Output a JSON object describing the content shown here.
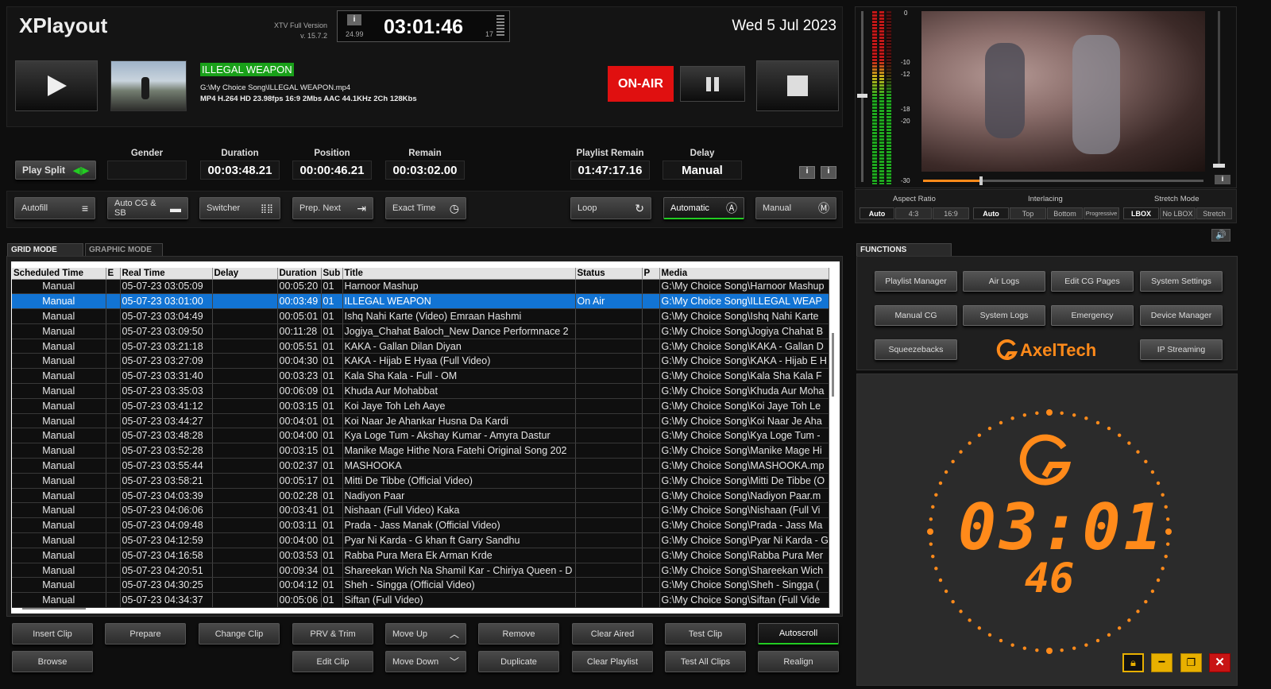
{
  "header": {
    "app_title": "XPlayout",
    "version_line1": "XTV Full Version",
    "version_line2": "v. 15.7.2",
    "clock": "03:01:46",
    "fps_left": "24.99",
    "fps_right": "17",
    "date": "Wed 5 Jul 2023"
  },
  "now_playing": {
    "title": "ILLEGAL WEAPON",
    "path": "G:\\My Choice Song\\ILLEGAL WEAPON.mp4",
    "specs": "MP4 H.264 HD 23.98fps 16:9 2Mbs AAC 44.1KHz 2Ch 128Kbs",
    "on_air": "ON-AIR"
  },
  "stats": {
    "play_split": "Play Split",
    "gender_label": "Gender",
    "gender_value": "",
    "duration_label": "Duration",
    "duration_value": "00:03:48.21",
    "position_label": "Position",
    "position_value": "00:00:46.21",
    "remain_label": "Remain",
    "remain_value": "00:03:02.00",
    "playlist_remain_label": "Playlist Remain",
    "playlist_remain_value": "01:47:17.16",
    "delay_label": "Delay",
    "delay_value": "Manual"
  },
  "toolbar": {
    "autofill": "Autofill",
    "auto_cg": "Auto CG & SB",
    "switcher": "Switcher",
    "prep_next": "Prep. Next",
    "exact_time": "Exact Time",
    "loop": "Loop",
    "automatic": "Automatic",
    "manual": "Manual"
  },
  "tabs": {
    "grid": "GRID MODE",
    "graphic": "GRAPHIC MODE",
    "functions": "FUNCTIONS"
  },
  "columns": {
    "scheduled": "Scheduled Time",
    "e": "E",
    "real": "Real Time",
    "delay": "Delay",
    "duration": "Duration",
    "sub": "Sub",
    "title": "Title",
    "status": "Status",
    "p": "P",
    "media": "Media"
  },
  "rows": [
    {
      "scheduled": "Manual",
      "real": "05-07-23  03:05:09",
      "duration": "00:05:20",
      "sub": "01",
      "title": "Harnoor Mashup",
      "status": "",
      "media": "G:\\My Choice Song\\Harnoor Mashup"
    },
    {
      "scheduled": "Manual",
      "real": "05-07-23  03:01:00",
      "duration": "00:03:49",
      "sub": "01",
      "title": "ILLEGAL WEAPON",
      "status": "On Air",
      "media": "G:\\My Choice Song\\ILLEGAL WEAP"
    },
    {
      "scheduled": "Manual",
      "real": "05-07-23  03:04:49",
      "duration": "00:05:01",
      "sub": "01",
      "title": "Ishq Nahi Karte (Video) Emraan Hashmi",
      "status": "",
      "media": "G:\\My Choice Song\\Ishq Nahi Karte"
    },
    {
      "scheduled": "Manual",
      "real": "05-07-23  03:09:50",
      "duration": "00:11:28",
      "sub": "01",
      "title": "Jogiya_Chahat Baloch_New Dance Performnace 2",
      "status": "",
      "media": "G:\\My Choice Song\\Jogiya Chahat B"
    },
    {
      "scheduled": "Manual",
      "real": "05-07-23  03:21:18",
      "duration": "00:05:51",
      "sub": "01",
      "title": "KAKA - Gallan Dilan Diyan",
      "status": "",
      "media": "G:\\My Choice Song\\KAKA - Gallan D"
    },
    {
      "scheduled": "Manual",
      "real": "05-07-23  03:27:09",
      "duration": "00:04:30",
      "sub": "01",
      "title": "KAKA - Hijab E Hyaa (Full Video)",
      "status": "",
      "media": "G:\\My Choice Song\\KAKA - Hijab E H"
    },
    {
      "scheduled": "Manual",
      "real": "05-07-23  03:31:40",
      "duration": "00:03:23",
      "sub": "01",
      "title": "Kala Sha Kala - Full - OM",
      "status": "",
      "media": "G:\\My Choice Song\\Kala Sha Kala F"
    },
    {
      "scheduled": "Manual",
      "real": "05-07-23  03:35:03",
      "duration": "00:06:09",
      "sub": "01",
      "title": "Khuda Aur Mohabbat",
      "status": "",
      "media": "G:\\My Choice Song\\Khuda Aur Moha"
    },
    {
      "scheduled": "Manual",
      "real": "05-07-23  03:41:12",
      "duration": "00:03:15",
      "sub": "01",
      "title": "Koi Jaye Toh Leh Aaye",
      "status": "",
      "media": "G:\\My Choice Song\\Koi Jaye Toh Le"
    },
    {
      "scheduled": "Manual",
      "real": "05-07-23  03:44:27",
      "duration": "00:04:01",
      "sub": "01",
      "title": "Koi Naar Je Ahankar Husna Da Kardi",
      "status": "",
      "media": "G:\\My Choice Song\\Koi Naar Je Aha"
    },
    {
      "scheduled": "Manual",
      "real": "05-07-23  03:48:28",
      "duration": "00:04:00",
      "sub": "01",
      "title": "Kya Loge Tum - Akshay Kumar - Amyra Dastur",
      "status": "",
      "media": "G:\\My Choice Song\\Kya Loge Tum -"
    },
    {
      "scheduled": "Manual",
      "real": "05-07-23  03:52:28",
      "duration": "00:03:15",
      "sub": "01",
      "title": "Manike Mage Hithe Nora Fatehi Original Song 202",
      "status": "",
      "media": "G:\\My Choice Song\\Manike Mage Hi"
    },
    {
      "scheduled": "Manual",
      "real": "05-07-23  03:55:44",
      "duration": "00:02:37",
      "sub": "01",
      "title": "MASHOOKA",
      "status": "",
      "media": "G:\\My Choice Song\\MASHOOKA.mp"
    },
    {
      "scheduled": "Manual",
      "real": "05-07-23  03:58:21",
      "duration": "00:05:17",
      "sub": "01",
      "title": "Mitti De Tibbe (Official Video)",
      "status": "",
      "media": "G:\\My Choice Song\\Mitti De Tibbe (O"
    },
    {
      "scheduled": "Manual",
      "real": "05-07-23  04:03:39",
      "duration": "00:02:28",
      "sub": "01",
      "title": "Nadiyon Paar",
      "status": "",
      "media": "G:\\My Choice Song\\Nadiyon Paar.m"
    },
    {
      "scheduled": "Manual",
      "real": "05-07-23  04:06:06",
      "duration": "00:03:41",
      "sub": "01",
      "title": "Nishaan (Full Video) Kaka",
      "status": "",
      "media": "G:\\My Choice Song\\Nishaan (Full Vi"
    },
    {
      "scheduled": "Manual",
      "real": "05-07-23  04:09:48",
      "duration": "00:03:11",
      "sub": "01",
      "title": "Prada - Jass Manak (Official Video)",
      "status": "",
      "media": "G:\\My Choice Song\\Prada - Jass Ma"
    },
    {
      "scheduled": "Manual",
      "real": "05-07-23  04:12:59",
      "duration": "00:04:00",
      "sub": "01",
      "title": "Pyar Ni Karda - G khan ft Garry Sandhu",
      "status": "",
      "media": "G:\\My Choice Song\\Pyar Ni Karda - G"
    },
    {
      "scheduled": "Manual",
      "real": "05-07-23  04:16:58",
      "duration": "00:03:53",
      "sub": "01",
      "title": "Rabba Pura Mera Ek Arman Krde",
      "status": "",
      "media": "G:\\My Choice Song\\Rabba Pura Mer"
    },
    {
      "scheduled": "Manual",
      "real": "05-07-23  04:20:51",
      "duration": "00:09:34",
      "sub": "01",
      "title": "Shareekan Wich Na Shamil Kar - Chiriya Queen - D",
      "status": "",
      "media": "G:\\My Choice Song\\Shareekan Wich"
    },
    {
      "scheduled": "Manual",
      "real": "05-07-23  04:30:25",
      "duration": "00:04:12",
      "sub": "01",
      "title": "Sheh - Singga (Official Video)",
      "status": "",
      "media": "G:\\My Choice Song\\Sheh - Singga ("
    },
    {
      "scheduled": "Manual",
      "real": "05-07-23  04:34:37",
      "duration": "00:05:06",
      "sub": "01",
      "title": "Siftan (Full Video)",
      "status": "",
      "media": "G:\\My Choice Song\\Siftan (Full Vide"
    }
  ],
  "bottom_buttons": {
    "insert_clip": "Insert Clip",
    "prepare": "Prepare",
    "change_clip": "Change Clip",
    "prv_trim": "PRV & Trim",
    "move_up": "Move Up",
    "remove": "Remove",
    "clear_aired": "Clear Aired",
    "test_clip": "Test Clip",
    "autoscroll": "Autoscroll",
    "browse": "Browse",
    "edit_clip": "Edit Clip",
    "move_down": "Move Down",
    "duplicate": "Duplicate",
    "clear_playlist": "Clear Playlist",
    "test_all": "Test All Clips",
    "realign": "Realign"
  },
  "vu": {
    "scale": [
      "0",
      "-10",
      "-12",
      "-18",
      "-20",
      "-30"
    ]
  },
  "video_settings": {
    "aspect_label": "Aspect Ratio",
    "aspect": [
      "Auto",
      "4:3",
      "16:9"
    ],
    "interlacing_label": "Interlacing",
    "interlacing": [
      "Auto",
      "Top",
      "Bottom",
      "Progressive"
    ],
    "stretch_label": "Stretch Mode",
    "stretch": [
      "LBOX",
      "No LBOX",
      "Stretch"
    ]
  },
  "functions": {
    "playlist_manager": "Playlist Manager",
    "air_logs": "Air Logs",
    "edit_cg": "Edit CG Pages",
    "system_settings": "System Settings",
    "manual_cg": "Manual CG",
    "system_logs": "System Logs",
    "emergency": "Emergency",
    "device_manager": "Device Manager",
    "squeezebacks": "Squeezebacks",
    "ip_streaming": "IP Streaming",
    "logo": "AxelTech"
  },
  "big_clock": {
    "hhmm": "03:01",
    "ss": "46"
  },
  "colors": {
    "accent_orange": "#ff8a1a",
    "on_air_red": "#e01010",
    "selection_blue": "#1274d4",
    "title_green": "#19a019"
  },
  "progress": {
    "clip_position_fraction": 0.2
  }
}
